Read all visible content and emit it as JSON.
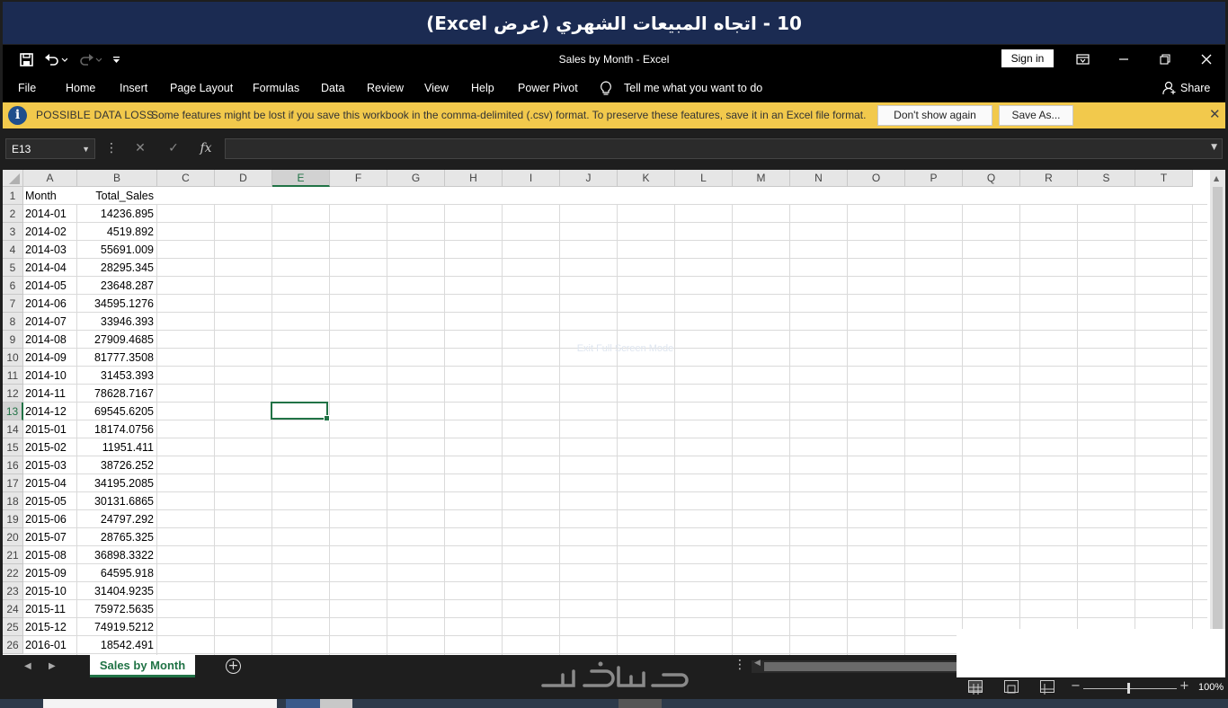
{
  "banner": {
    "title": "10 - اتجاه المبيعات الشهري (عرض Excel)"
  },
  "titlebar": {
    "document_title": "Sales by Month  -  Excel",
    "sign_in": "Sign in"
  },
  "ribbon": {
    "tabs": [
      "File",
      "Home",
      "Insert",
      "Page Layout",
      "Formulas",
      "Data",
      "Review",
      "View",
      "Help",
      "Power Pivot"
    ],
    "tell_me": "Tell me what you want to do",
    "share": "Share"
  },
  "warning": {
    "title": "POSSIBLE DATA LOSS",
    "message": "Some features might be lost if you save this workbook in the comma-delimited (.csv) format. To preserve these features, save it in an Excel file format.",
    "dont_show": "Don't show again",
    "save_as": "Save As..."
  },
  "formula_bar": {
    "name_box": "E13",
    "formula": ""
  },
  "grid": {
    "columns": [
      "A",
      "B",
      "C",
      "D",
      "E",
      "F",
      "G",
      "H",
      "I",
      "J",
      "K",
      "L",
      "M",
      "N",
      "O",
      "P",
      "Q",
      "R",
      "S",
      "T"
    ],
    "selected_column": "E",
    "selected_row": 13,
    "rows": [
      [
        "Month",
        "Total_Sales"
      ],
      [
        "2014-01",
        "14236.895"
      ],
      [
        "2014-02",
        "4519.892"
      ],
      [
        "2014-03",
        "55691.009"
      ],
      [
        "2014-04",
        "28295.345"
      ],
      [
        "2014-05",
        "23648.287"
      ],
      [
        "2014-06",
        "34595.1276"
      ],
      [
        "2014-07",
        "33946.393"
      ],
      [
        "2014-08",
        "27909.4685"
      ],
      [
        "2014-09",
        "81777.3508"
      ],
      [
        "2014-10",
        "31453.393"
      ],
      [
        "2014-11",
        "78628.7167"
      ],
      [
        "2014-12",
        "69545.6205"
      ],
      [
        "2015-01",
        "18174.0756"
      ],
      [
        "2015-02",
        "11951.411"
      ],
      [
        "2015-03",
        "38726.252"
      ],
      [
        "2015-04",
        "34195.2085"
      ],
      [
        "2015-05",
        "30131.6865"
      ],
      [
        "2015-06",
        "24797.292"
      ],
      [
        "2015-07",
        "28765.325"
      ],
      [
        "2015-08",
        "36898.3322"
      ],
      [
        "2015-09",
        "64595.918"
      ],
      [
        "2015-10",
        "31404.9235"
      ],
      [
        "2015-11",
        "75972.5635"
      ],
      [
        "2015-12",
        "74919.5212"
      ],
      [
        "2016-01",
        "18542.491"
      ]
    ]
  },
  "sheet_tabs": {
    "active": "Sales by Month"
  },
  "status": {
    "zoom": "100%"
  },
  "icons": {
    "save": "save-icon",
    "undo": "undo-icon",
    "redo": "redo-icon",
    "customize": "customize-qat-icon",
    "ribbon_display": "ribbon-display-icon",
    "minimize": "minimize-icon",
    "restore": "restore-icon",
    "close": "close-icon",
    "lightbulb": "lightbulb-icon",
    "person": "person-icon",
    "info": "info-icon"
  },
  "colors": {
    "banner": "#1b2b52",
    "accent": "#217346",
    "warning_bg": "#f2c94c"
  }
}
